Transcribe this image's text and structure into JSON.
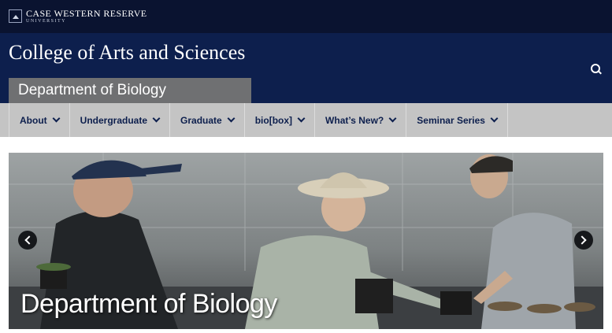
{
  "topbar": {
    "logo_line1": "CASE WESTERN RESERVE",
    "logo_line2": "UNIVERSITY"
  },
  "header": {
    "college_title": "College of Arts and Sciences",
    "department": "Department of Biology",
    "search_icon": "search-icon"
  },
  "nav": {
    "items": [
      {
        "label": "About"
      },
      {
        "label": "Undergraduate"
      },
      {
        "label": "Graduate"
      },
      {
        "label": "bio[box]"
      },
      {
        "label": "What’s New?"
      },
      {
        "label": "Seminar Series"
      }
    ]
  },
  "hero": {
    "caption": "Department of Biology",
    "prev_icon": "chevron-left-icon",
    "next_icon": "chevron-right-icon"
  },
  "colors": {
    "topbar": "#0a1330",
    "header": "#0d1f4d",
    "department_tab": "#6f7072",
    "nav": "#c4c4c4",
    "nav_text": "#0d1f4d"
  }
}
